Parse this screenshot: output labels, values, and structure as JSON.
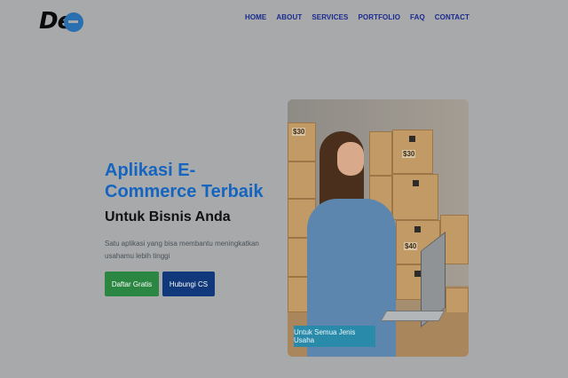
{
  "brand": {
    "logo_text": "De"
  },
  "nav": {
    "items": [
      "HOME",
      "ABOUT",
      "SERVICES",
      "PORTFOLIO",
      "FAQ",
      "CONTACT"
    ]
  },
  "hero": {
    "title": "Aplikasi E-Commerce Terbaik",
    "subtitle": "Untuk Bisnis Anda",
    "description": "Satu aplikasi yang bisa membantu meningkatkan usahamu lebih tinggi",
    "primary_button": "Daftar Gratis",
    "secondary_button": "Hubungi CS",
    "image_badge": "Untuk Semua Jenis Usaha",
    "box_labels": [
      "$30",
      "$30",
      "$40"
    ]
  },
  "colors": {
    "background": "#a7a9ab",
    "nav_text": "#1b2a8f",
    "title": "#1565c0",
    "primary_button": "#2a8640",
    "secondary_button": "#11387a",
    "badge": "#2a8aa9"
  }
}
